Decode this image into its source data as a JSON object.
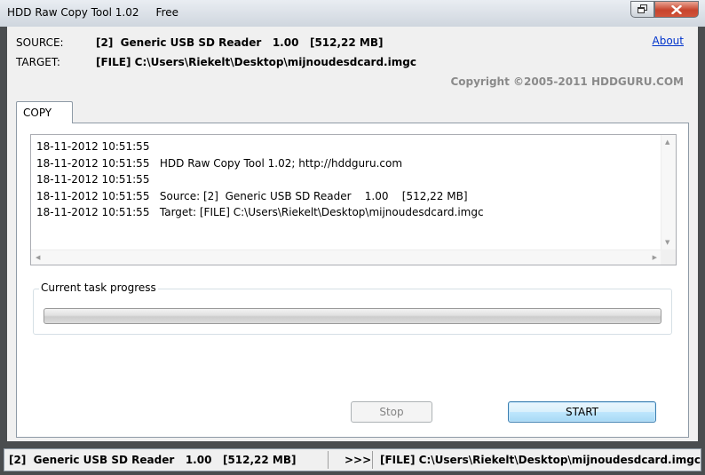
{
  "window": {
    "title": "HDD Raw Copy Tool 1.02     Free"
  },
  "header": {
    "source_label": "SOURCE:",
    "source_value": "[2]  Generic USB SD Reader   1.00   [512,22 MB]",
    "target_label": "TARGET:",
    "target_value": "[FILE] C:\\Users\\Riekelt\\Desktop\\mijnoudesdcard.imgc",
    "about_link": "About",
    "copyright": "Copyright ©2005-2011 HDDGURU.COM"
  },
  "tabs": [
    {
      "label": "COPY",
      "active": true
    }
  ],
  "log": {
    "lines": [
      "18-11-2012 10:51:55",
      "18-11-2012 10:51:55   HDD Raw Copy Tool 1.02; http://hddguru.com",
      "18-11-2012 10:51:55",
      "18-11-2012 10:51:55   Source: [2]  Generic USB SD Reader    1.00    [512,22 MB]",
      "18-11-2012 10:51:55   Target: [FILE] C:\\Users\\Riekelt\\Desktop\\mijnoudesdcard.imgc"
    ]
  },
  "progress": {
    "title": "Current task progress",
    "fraction": 0
  },
  "buttons": {
    "stop_label": "Stop",
    "start_label": "START"
  },
  "statusbar": {
    "source": "[2]  Generic USB SD Reader   1.00   [512,22 MB]",
    "arrow": ">>>",
    "target": "[FILE] C:\\Users\\Riekelt\\Desktop\\mijnoudesdcard.imgc"
  },
  "icons": {
    "restore": "restore-icon",
    "close": "close-icon"
  },
  "colors": {
    "link": "#0033cc",
    "copyright": "#8a8a8a",
    "start_border": "#3c7fb1"
  }
}
